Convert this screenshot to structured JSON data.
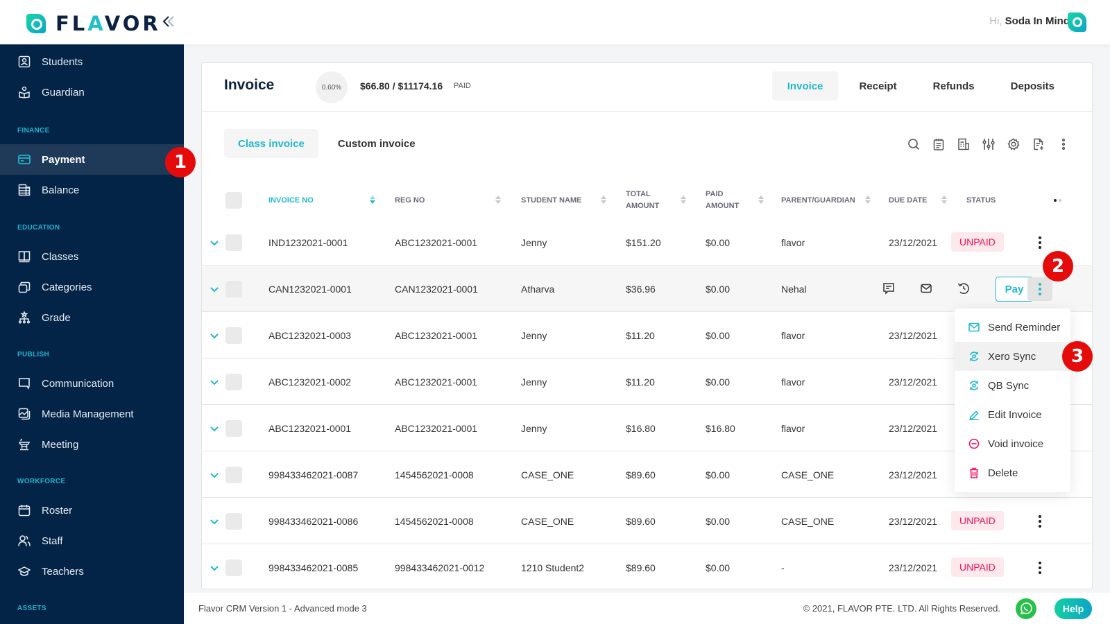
{
  "brand": {
    "name_left": "FL",
    "name_accent": "A",
    "name_right": "VOR",
    "collapse_icon": "double-chevron-left"
  },
  "user": {
    "greeting": "Hi,",
    "name": "Soda In Mind"
  },
  "sidebar": {
    "items": [
      {
        "label": "Students",
        "icon": "student-id-icon"
      },
      {
        "label": "Guardian",
        "icon": "guardian-icon"
      },
      {
        "section": "FINANCE"
      },
      {
        "label": "Payment",
        "icon": "card-icon",
        "active": true
      },
      {
        "label": "Balance",
        "icon": "ledger-icon"
      },
      {
        "section": "EDUCATION"
      },
      {
        "label": "Classes",
        "icon": "book-icon"
      },
      {
        "label": "Categories",
        "icon": "stack-icon"
      },
      {
        "label": "Grade",
        "icon": "hierarchy-icon"
      },
      {
        "section": "PUBLISH"
      },
      {
        "label": "Communication",
        "icon": "chat-icon"
      },
      {
        "label": "Media Management",
        "icon": "image-icon"
      },
      {
        "label": "Meeting",
        "icon": "podium-icon"
      },
      {
        "section": "WORKFORCE"
      },
      {
        "label": "Roster",
        "icon": "calendar-icon"
      },
      {
        "label": "Staff",
        "icon": "users-icon"
      },
      {
        "label": "Teachers",
        "icon": "graduation-cap-icon"
      },
      {
        "section": "ASSETS"
      }
    ]
  },
  "header": {
    "title": "Invoice",
    "paid_percent": "0.60%",
    "amount": "$66.80 / $11174.16",
    "amount_label": "PAID",
    "tabs": [
      {
        "label": "Invoice",
        "active": true
      },
      {
        "label": "Receipt"
      },
      {
        "label": "Refunds"
      },
      {
        "label": "Deposits"
      }
    ]
  },
  "subtabs": [
    {
      "label": "Class invoice",
      "active": true
    },
    {
      "label": "Custom invoice"
    }
  ],
  "toolbar": [
    "search-icon",
    "notepad-icon",
    "receipt-icon",
    "filter-sliders-icon",
    "gear-icon",
    "file-add-icon",
    "more-vertical-icon"
  ],
  "table": {
    "columns": [
      {
        "label": "INVOICE NO",
        "active": true
      },
      {
        "label": "REG NO"
      },
      {
        "label": "STUDENT NAME"
      },
      {
        "label_line1": "TOTAL",
        "label_line2": "AMOUNT"
      },
      {
        "label_line1": "PAID",
        "label_line2": "AMOUNT"
      },
      {
        "label": "PARENT/GUARDIAN"
      },
      {
        "label": "DUE DATE"
      },
      {
        "label": "STATUS"
      }
    ],
    "rows": [
      {
        "invoice_no": "IND1232021-0001",
        "reg_no": "ABC1232021-0001",
        "student": "Jenny",
        "total": "$151.20",
        "paid": "$0.00",
        "parent": "flavor",
        "due": "23/12/2021",
        "status": "UNPAID"
      },
      {
        "invoice_no": "CAN1232021-0001",
        "reg_no": "CAN1232021-0001",
        "student": "Atharva",
        "total": "$36.96",
        "paid": "$0.00",
        "parent": "Nehal",
        "due": "",
        "status": "",
        "pay_label": "Pay"
      },
      {
        "invoice_no": "ABC1232021-0003",
        "reg_no": "ABC1232021-0001",
        "student": "Jenny",
        "total": "$11.20",
        "paid": "$0.00",
        "parent": "flavor",
        "due": "23/12/2021",
        "status": ""
      },
      {
        "invoice_no": "ABC1232021-0002",
        "reg_no": "ABC1232021-0001",
        "student": "Jenny",
        "total": "$11.20",
        "paid": "$0.00",
        "parent": "flavor",
        "due": "23/12/2021",
        "status": ""
      },
      {
        "invoice_no": "ABC1232021-0001",
        "reg_no": "ABC1232021-0001",
        "student": "Jenny",
        "total": "$16.80",
        "paid": "$16.80",
        "parent": "flavor",
        "due": "23/12/2021",
        "status": ""
      },
      {
        "invoice_no": "998433462021-0087",
        "reg_no": "1454562021-0008",
        "student": "CASE_ONE",
        "total": "$89.60",
        "paid": "$0.00",
        "parent": "CASE_ONE",
        "due": "23/12/2021",
        "status": ""
      },
      {
        "invoice_no": "998433462021-0086",
        "reg_no": "1454562021-0008",
        "student": "CASE_ONE",
        "total": "$89.60",
        "paid": "$0.00",
        "parent": "CASE_ONE",
        "due": "23/12/2021",
        "status": "UNPAID"
      },
      {
        "invoice_no": "998433462021-0085",
        "reg_no": "998433462021-0012",
        "student": "1210 Student2",
        "total": "$89.60",
        "paid": "$0.00",
        "parent": "-",
        "due": "23/12/2021",
        "status": "UNPAID"
      }
    ]
  },
  "row_menu": [
    {
      "label": "Send Reminder",
      "icon": "mail-icon",
      "color": "#21b8cc"
    },
    {
      "label": "Xero Sync",
      "icon": "sync-icon",
      "color": "#21b8cc",
      "hover": true
    },
    {
      "label": "QB Sync",
      "icon": "sync-icon",
      "color": "#21b8cc"
    },
    {
      "label": "Edit Invoice",
      "icon": "pencil-icon",
      "color": "#21b8cc"
    },
    {
      "label": "Void invoice",
      "icon": "minus-circle-icon",
      "color": "#f0125a"
    },
    {
      "label": "Delete",
      "icon": "trash-icon",
      "color": "#f0125a"
    }
  ],
  "annotations": [
    "1",
    "2",
    "3"
  ],
  "footer": {
    "version": "Flavor CRM Version 1 - Advanced mode 3",
    "copyright": "© 2021, FLAVOR PTE. LTD. All Rights Reserved.",
    "help_label": "Help"
  },
  "colors": {
    "accent": "#21b8cc",
    "sidebar": "#032446",
    "danger": "#f0125a",
    "annotation": "#e50b0b"
  }
}
